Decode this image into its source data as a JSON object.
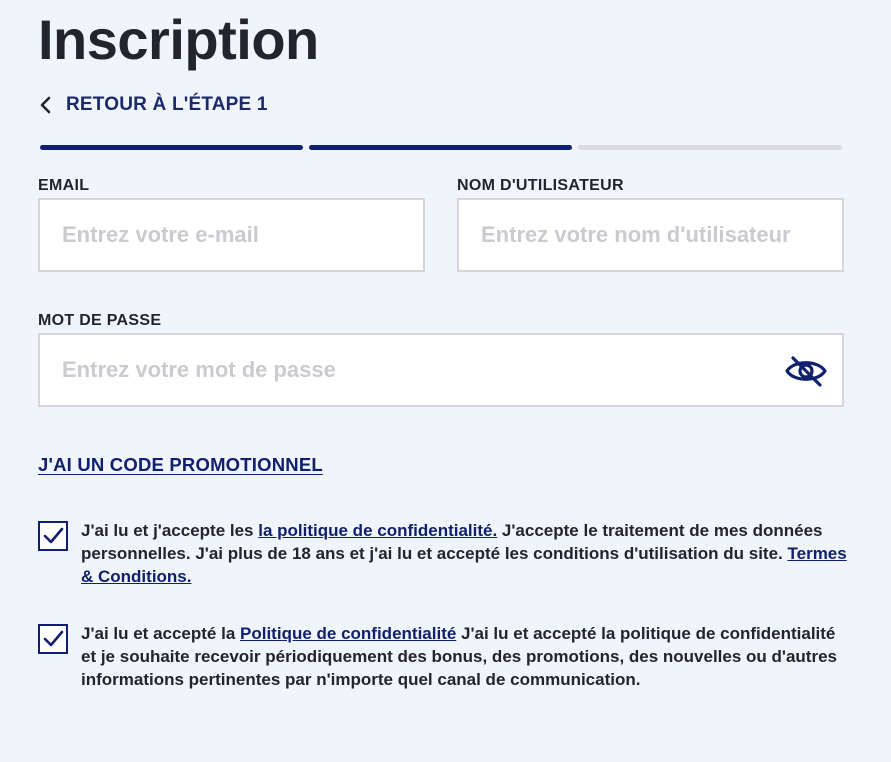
{
  "page": {
    "title": "Inscription"
  },
  "nav": {
    "back_label": "RETOUR À L'ÉTAPE 1"
  },
  "progress": {
    "total_steps": 3,
    "current_step": 2
  },
  "form": {
    "email": {
      "label": "EMAIL",
      "placeholder": "Entrez votre e-mail",
      "value": ""
    },
    "username": {
      "label": "NOM D'UTILISATEUR",
      "placeholder": "Entrez votre nom d'utilisateur",
      "value": ""
    },
    "password": {
      "label": "MOT DE PASSE",
      "placeholder": "Entrez votre mot de passe",
      "value": "",
      "toggle_icon": "eye-slash-icon"
    },
    "promo_link": "J'AI UN CODE PROMOTIONNEL"
  },
  "consents": [
    {
      "checked": true,
      "text_before": "J'ai lu et j'accepte les ",
      "link1": "la politique de confidentialité.",
      "text_middle": " J'accepte le traitement de mes données personnelles. J'ai plus de 18 ans et j'ai lu et accepté les conditions d'utilisation du site. ",
      "link2": "Termes & Conditions."
    },
    {
      "checked": true,
      "text_before": "J'ai lu et accepté la ",
      "link1": "Politique de confidentialité",
      "text_after": " J'ai lu et accepté la politique de confidentialité et je souhaite recevoir périodiquement des bonus, des promotions, des nouvelles ou d'autres informations pertinentes par n'importe quel canal de communication."
    }
  ],
  "colors": {
    "brand": "#10206e",
    "background": "#f0f4fb",
    "progress_inactive": "#d9dbe0"
  }
}
